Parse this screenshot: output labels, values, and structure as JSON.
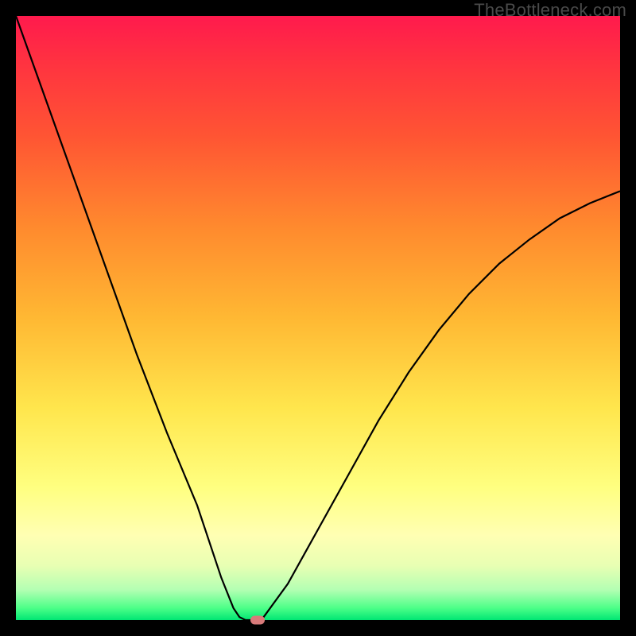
{
  "watermark": "TheBottleneck.com",
  "chart_data": {
    "type": "line",
    "title": "",
    "xlabel": "",
    "ylabel": "",
    "xlim": [
      0,
      100
    ],
    "ylim": [
      0,
      100
    ],
    "grid": false,
    "legend": false,
    "series": [
      {
        "name": "bottleneck-curve",
        "x": [
          0,
          5,
          10,
          15,
          20,
          25,
          30,
          34,
          36,
          37,
          38,
          39.5,
          41,
          45,
          50,
          55,
          60,
          65,
          70,
          75,
          80,
          85,
          90,
          95,
          100
        ],
        "y": [
          100,
          86,
          72,
          58,
          44,
          31,
          19,
          7,
          2,
          0.5,
          0,
          0,
          0.5,
          6,
          15,
          24,
          33,
          41,
          48,
          54,
          59,
          63,
          66.5,
          69,
          71
        ]
      }
    ],
    "markers": [
      {
        "name": "optimum-marker",
        "x": 40,
        "y": 0,
        "color": "#d87a7a"
      }
    ],
    "gradient_stops": [
      {
        "pos": 0,
        "color": "#ff1a4d"
      },
      {
        "pos": 35,
        "color": "#ff8a2e"
      },
      {
        "pos": 65,
        "color": "#ffe64d"
      },
      {
        "pos": 86,
        "color": "#ffffb3"
      },
      {
        "pos": 100,
        "color": "#00e673"
      }
    ]
  }
}
